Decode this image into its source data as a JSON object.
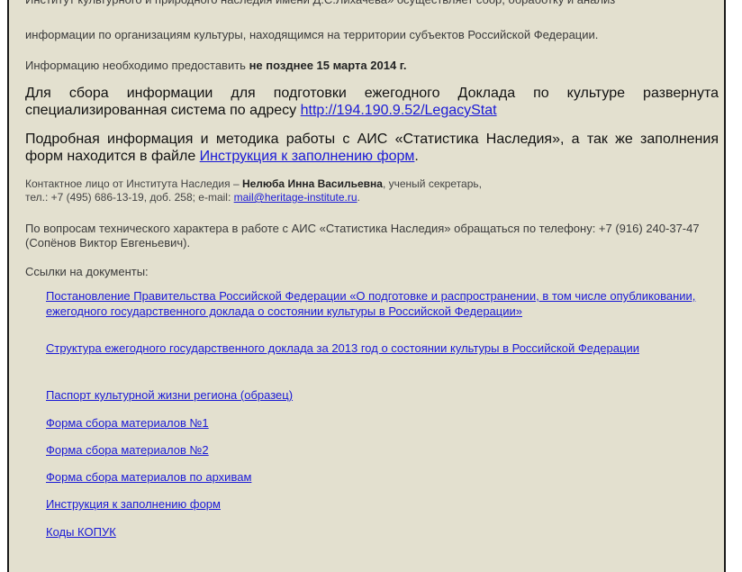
{
  "intro": {
    "cut_line": "Институт культурного и природного наследия имени Д.С.Лихачёва» осуществляет сбор, обработку и анализ",
    "line2": "информации по организациям культуры, находящимся на территории субъектов Российской Федерации."
  },
  "deadline": {
    "prefix": "Информацию необходимо предоставить ",
    "date": "не позднее 15 марта 2014 г."
  },
  "system": {
    "text": "Для сбора информации для подготовки ежегодного Доклада по культуре развернута специализированная система по адресу ",
    "link": "http://194.190.9.52/LegacyStat"
  },
  "instructions": {
    "text": "Подробная информация и методика работы с АИС «Статистика Наследия», а так же заполнения форм находится в файле ",
    "link": "Инструкция к заполнению форм",
    "suffix": "."
  },
  "contact": {
    "prefix": "Контактное лицо от Института Наследия – ",
    "name": "Нелюба Инна Васильевна",
    "role": ", ученый секретарь,",
    "phone": "тел.: +7 (495) 686-13-19, доб. 258; e-mail: ",
    "email": "mail@heritage-institute.ru",
    "email_suffix": "."
  },
  "tech": {
    "text": "По вопросам технического характера в работе с АИС «Статистика Наследия» обращаться по телефону: +7 (916) 240-37-47 (Сопёнов Виктор Евгеньевич)."
  },
  "docs": {
    "heading": "Ссылки на документы:",
    "items": [
      "Постановление Правительства Российской Федерации «О подготовке и распространении, в том числе опубликовании, ежегодного государственного доклада о состоянии культуры в Российской Федерации»",
      "Структура ежегодного государственного доклада за 2013 год о состоянии культуры в Российской Федерации",
      "Паспорт культурной жизни региона (образец)",
      "Форма сбора материалов №1",
      "Форма сбора материалов №2",
      "Форма сбора материалов по архивам",
      "Инструкция к заполнению форм",
      "Коды КОПУК"
    ]
  }
}
